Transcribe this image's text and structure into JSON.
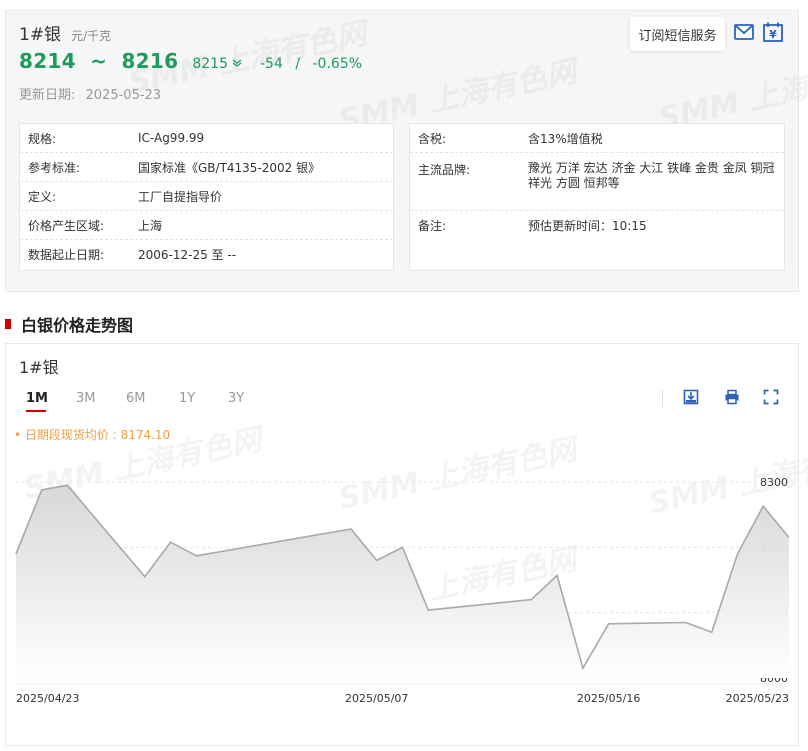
{
  "header": {
    "product": "1#银",
    "unit": "元/千克",
    "price_low": "8214",
    "price_sep": "~",
    "price_high": "8216",
    "average": "8215",
    "change": "-54",
    "change_sep": "/",
    "change_pct": "-0.65%",
    "update_label": "更新日期:",
    "update_date": "2025-05-23",
    "subscribe_label": "订阅短信服务",
    "icons": [
      "mail-icon",
      "calendar-yen-icon"
    ]
  },
  "info_left": [
    {
      "label": "规格:",
      "value": "IC-Ag99.99"
    },
    {
      "label": "参考标准:",
      "value": "国家标准《GB/T4135-2002 银》"
    },
    {
      "label": "定义:",
      "value": "工厂自提指导价"
    },
    {
      "label": "价格产生区域:",
      "value": "上海"
    },
    {
      "label": "数据起止日期:",
      "value": "2006-12-25 至 --"
    }
  ],
  "info_right": [
    {
      "label": "含税:",
      "value": "含13%增值税"
    },
    {
      "label": "主流品牌:",
      "value": "豫光 万洋 宏达 济金 大江 铁峰 金贵 金凤 铜冠 祥光 方圆 恒邦等"
    },
    {
      "label": "备注:",
      "value": "预估更新时间：10:15"
    }
  ],
  "watermark": "SMM 上海有色网",
  "section_title": "白银价格走势图",
  "chart_panel": {
    "name": "1#银",
    "tabs": [
      "1M",
      "3M",
      "6M",
      "1Y",
      "3Y"
    ],
    "active_tab": "1M",
    "avg_label": "• 日期段现货均价 : 8174.10",
    "tool_icons": [
      "download-icon",
      "print-icon",
      "fullscreen-icon"
    ]
  },
  "colors": {
    "price_green": "#1c9b5b",
    "accent_red": "#cc0000",
    "avg_orange": "#f0a040",
    "line_gray": "#a9a9a9"
  },
  "chart_data": {
    "type": "area",
    "title": "",
    "xlabel": "",
    "ylabel": "",
    "x": [
      "2025-04-23",
      "2025-04-24",
      "2025-04-25",
      "2025-04-28",
      "2025-04-29",
      "2025-04-30",
      "2025-05-06",
      "2025-05-07",
      "2025-05-08",
      "2025-05-09",
      "2025-05-12",
      "2025-05-13",
      "2025-05-14",
      "2025-05-15",
      "2025-05-16",
      "2025-05-19",
      "2025-05-20",
      "2025-05-21",
      "2025-05-22",
      "2025-05-23"
    ],
    "values": [
      8190,
      8288,
      8295,
      8155,
      8208,
      8187,
      8228,
      8180,
      8200,
      8104,
      8116,
      8120,
      8157,
      8015,
      8083,
      8085,
      8070,
      8190,
      8263,
      8215
    ],
    "x_tick_labels": [
      "2025/04/23",
      "2025/05/07",
      "2025/05/16",
      "2025/05/23"
    ],
    "x_tick_dates": [
      "2025-04-23",
      "2025-05-07",
      "2025-05-16",
      "2025-05-23"
    ],
    "y_ticks": [
      8000,
      8100,
      8200,
      8300
    ],
    "ylim": [
      8000,
      8300
    ],
    "grid": true,
    "y_axis_side": "right",
    "legend": "none"
  }
}
